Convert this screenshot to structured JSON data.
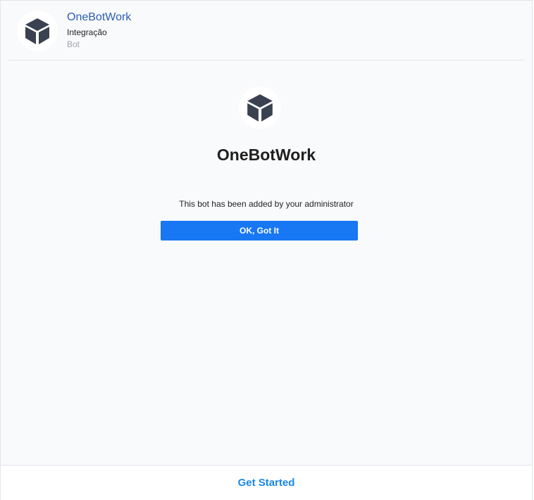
{
  "header": {
    "title": "OneBotWork",
    "subtitle": "Integração",
    "type": "Bot",
    "avatar_icon": "cube-icon"
  },
  "main": {
    "avatar_icon": "cube-icon",
    "title": "OneBotWork",
    "notice": "This bot has been added by your administrator",
    "ok_label": "OK, Got It"
  },
  "footer": {
    "get_started_label": "Get Started"
  },
  "colors": {
    "link_blue": "#2a5db0",
    "button_blue": "#1877f2",
    "get_started_blue": "#1a87e6",
    "icon_dark": "#3a4150",
    "background": "#f9fafc"
  }
}
